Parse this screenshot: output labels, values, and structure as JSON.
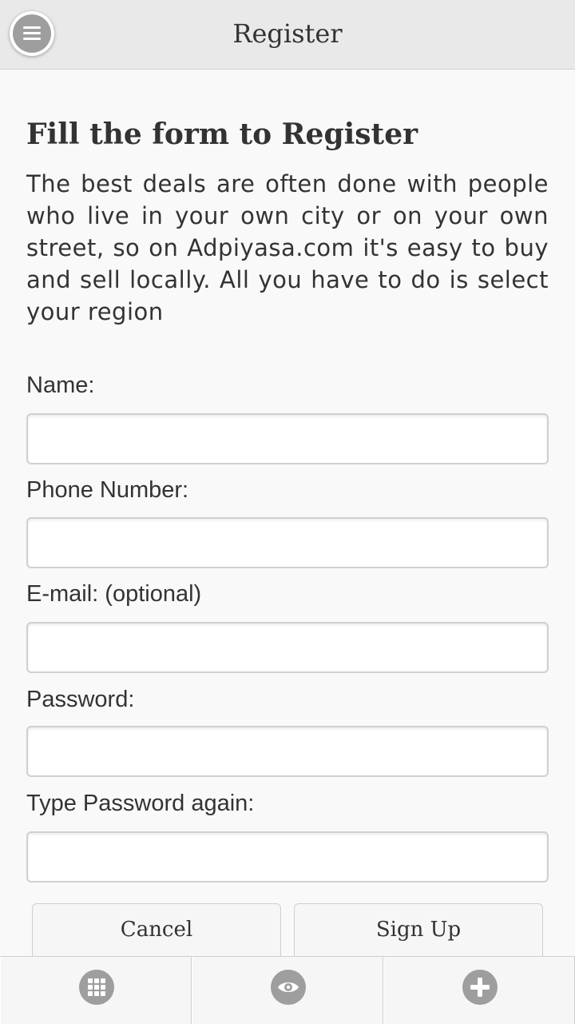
{
  "header": {
    "title": "Register",
    "menu_icon": "hamburger-menu-icon"
  },
  "form": {
    "title": "Fill the form to Register",
    "intro": "The best deals are often done with people who live in your own city or on your own street, so on Adpiyasa.com it's easy to buy and sell locally. All you have to do is select your region",
    "fields": [
      {
        "label": "Name:",
        "value": "",
        "placeholder": ""
      },
      {
        "label": "Phone Number:",
        "value": "",
        "placeholder": ""
      },
      {
        "label": "E-mail: (optional)",
        "value": "",
        "placeholder": ""
      },
      {
        "label": "Password:",
        "value": "",
        "placeholder": ""
      },
      {
        "label": "Type Password again:",
        "value": "",
        "placeholder": ""
      }
    ],
    "cancel_label": "Cancel",
    "signup_label": "Sign Up"
  },
  "tabbar": {
    "items": [
      {
        "icon": "grid-icon"
      },
      {
        "icon": "eye-icon"
      },
      {
        "icon": "plus-icon"
      }
    ]
  },
  "colors": {
    "header_bg": "#e9e9e9",
    "page_bg": "#f9f9f9",
    "icon_gray": "#9e9e9e",
    "text": "#333333"
  }
}
